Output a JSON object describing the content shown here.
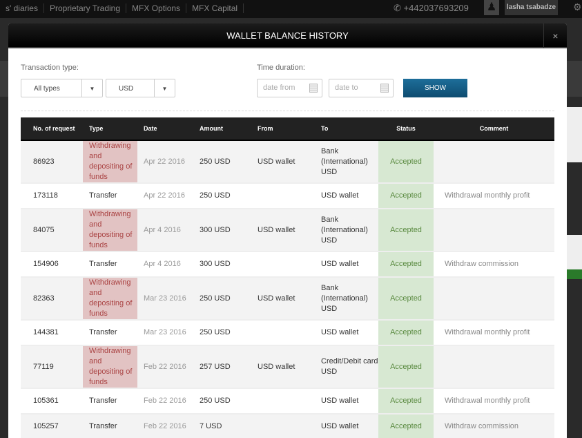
{
  "topbar": {
    "nav": [
      "s' diaries",
      "Proprietary Trading",
      "MFX Options",
      "MFX Capital"
    ],
    "phone": "+442037693209",
    "user": "lasha tsabadze"
  },
  "modal": {
    "title": "WALLET BALANCE HISTORY",
    "close": "×",
    "filters": {
      "type_label": "Transaction type:",
      "type_value": "All types",
      "currency_value": "USD",
      "time_label": "Time duration:",
      "date_from_placeholder": "date from",
      "date_to_placeholder": "date to",
      "show": "SHOW"
    },
    "columns": [
      "No. of request",
      "Type",
      "Date",
      "Amount",
      "From",
      "To",
      "Status",
      "Comment"
    ],
    "rows": [
      {
        "no": "86923",
        "type": "Withdrawing and depositing of funds",
        "date": "Apr 22 2016",
        "amount": "250 USD",
        "from": "USD wallet",
        "to": "Bank (International) USD",
        "status": "Accepted",
        "comment": ""
      },
      {
        "no": "173118",
        "type": "Transfer",
        "date": "Apr 22 2016",
        "amount": "250 USD",
        "from": "",
        "to": "USD wallet",
        "status": "Accepted",
        "comment": "Withdrawal monthly profit"
      },
      {
        "no": "84075",
        "type": "Withdrawing and depositing of funds",
        "date": "Apr 4 2016",
        "amount": "300 USD",
        "from": "USD wallet",
        "to": "Bank (International) USD",
        "status": "Accepted",
        "comment": ""
      },
      {
        "no": "154906",
        "type": "Transfer",
        "date": "Apr 4 2016",
        "amount": "300 USD",
        "from": "",
        "to": "USD wallet",
        "status": "Accepted",
        "comment": "Withdraw commission"
      },
      {
        "no": "82363",
        "type": "Withdrawing and depositing of funds",
        "date": "Mar 23 2016",
        "amount": "250 USD",
        "from": "USD wallet",
        "to": "Bank (International) USD",
        "status": "Accepted",
        "comment": ""
      },
      {
        "no": "144381",
        "type": "Transfer",
        "date": "Mar 23 2016",
        "amount": "250 USD",
        "from": "",
        "to": "USD wallet",
        "status": "Accepted",
        "comment": "Withdrawal monthly profit"
      },
      {
        "no": "77119",
        "type": "Withdrawing and depositing of funds",
        "date": "Feb 22 2016",
        "amount": "257 USD",
        "from": "USD wallet",
        "to": "Credit/Debit card USD",
        "status": "Accepted",
        "comment": ""
      },
      {
        "no": "105361",
        "type": "Transfer",
        "date": "Feb 22 2016",
        "amount": "250 USD",
        "from": "",
        "to": "USD wallet",
        "status": "Accepted",
        "comment": "Withdrawal monthly profit"
      },
      {
        "no": "105257",
        "type": "Transfer",
        "date": "Feb 22 2016",
        "amount": "7 USD",
        "from": "",
        "to": "USD wallet",
        "status": "Accepted",
        "comment": "Withdraw commission"
      }
    ]
  }
}
